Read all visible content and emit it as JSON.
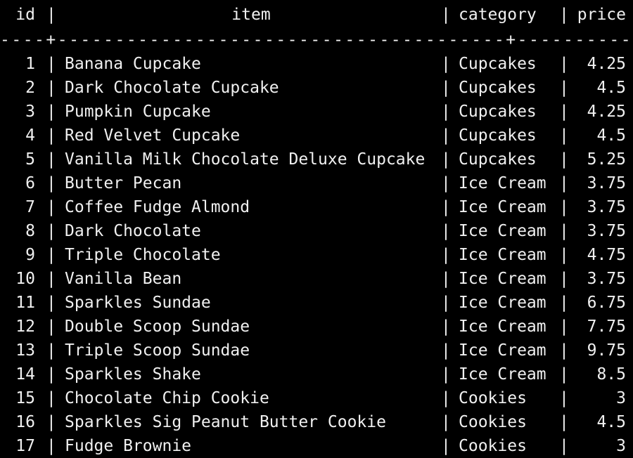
{
  "colors": {
    "background": "#000000",
    "text": "#f0f0f0"
  },
  "table": {
    "separator": "|",
    "divider": "----+---------------------------------------+------------+-------",
    "headers": {
      "id": "id",
      "item": "item",
      "category": "category",
      "price": "price"
    },
    "rows": [
      {
        "id": "1",
        "item": "Banana Cupcake",
        "category": "Cupcakes",
        "price": "4.25"
      },
      {
        "id": "2",
        "item": "Dark Chocolate Cupcake",
        "category": "Cupcakes",
        "price": "4.5"
      },
      {
        "id": "3",
        "item": "Pumpkin Cupcake",
        "category": "Cupcakes",
        "price": "4.25"
      },
      {
        "id": "4",
        "item": "Red Velvet Cupcake",
        "category": "Cupcakes",
        "price": "4.5"
      },
      {
        "id": "5",
        "item": "Vanilla Milk Chocolate Deluxe Cupcake",
        "category": "Cupcakes",
        "price": "5.25"
      },
      {
        "id": "6",
        "item": "Butter Pecan",
        "category": "Ice Cream",
        "price": "3.75"
      },
      {
        "id": "7",
        "item": "Coffee Fudge Almond",
        "category": "Ice Cream",
        "price": "3.75"
      },
      {
        "id": "8",
        "item": "Dark Chocolate",
        "category": "Ice Cream",
        "price": "3.75"
      },
      {
        "id": "9",
        "item": "Triple Chocolate",
        "category": "Ice Cream",
        "price": "4.75"
      },
      {
        "id": "10",
        "item": "Vanilla Bean",
        "category": "Ice Cream",
        "price": "3.75"
      },
      {
        "id": "11",
        "item": "Sparkles Sundae",
        "category": "Ice Cream",
        "price": "6.75"
      },
      {
        "id": "12",
        "item": "Double Scoop Sundae",
        "category": "Ice Cream",
        "price": "7.75"
      },
      {
        "id": "13",
        "item": "Triple Scoop Sundae",
        "category": "Ice Cream",
        "price": "9.75"
      },
      {
        "id": "14",
        "item": "Sparkles Shake",
        "category": "Ice Cream",
        "price": "8.5"
      },
      {
        "id": "15",
        "item": "Chocolate Chip Cookie",
        "category": "Cookies",
        "price": "3"
      },
      {
        "id": "16",
        "item": "Sparkles Sig Peanut Butter Cookie",
        "category": "Cookies",
        "price": "4.5"
      },
      {
        "id": "17",
        "item": "Fudge Brownie",
        "category": "Cookies",
        "price": "3"
      }
    ]
  }
}
